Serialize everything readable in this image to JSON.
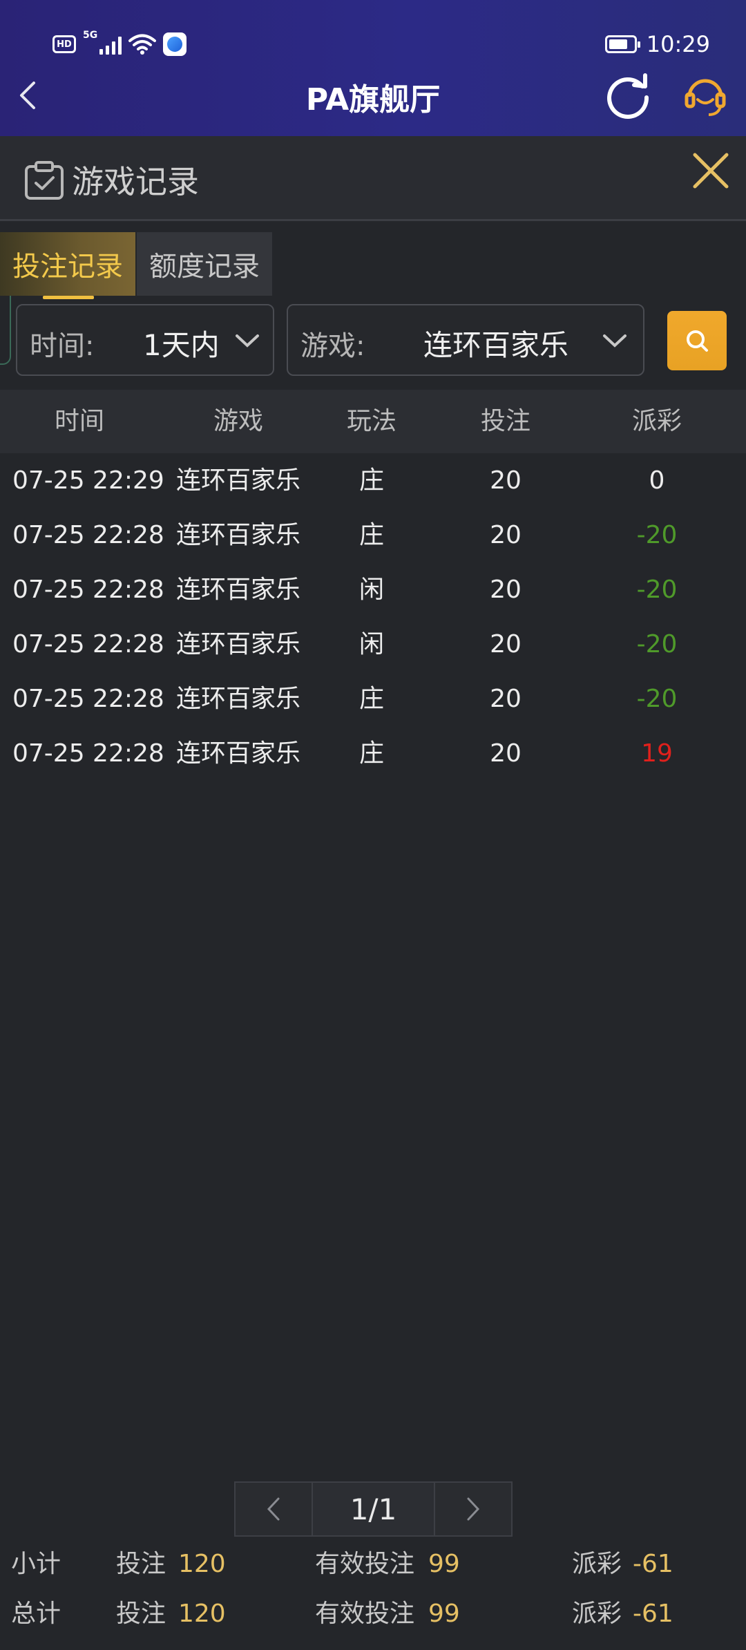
{
  "status": {
    "time": "10:29",
    "hd": "HD",
    "network": "5G"
  },
  "header": {
    "title": "PA旗舰厅"
  },
  "section": {
    "title": "游戏记录"
  },
  "tabs": [
    {
      "label": "投注记录",
      "active": true
    },
    {
      "label": "额度记录",
      "active": false
    }
  ],
  "filters": {
    "time": {
      "label": "时间:",
      "value": "1天内"
    },
    "game": {
      "label": "游戏:",
      "value": "连环百家乐"
    }
  },
  "table": {
    "columns": [
      "时间",
      "游戏",
      "玩法",
      "投注",
      "派彩"
    ],
    "rows": [
      {
        "time": "07-25 22:29",
        "game": "连环百家乐",
        "play": "庄",
        "bet": "20",
        "payout": "0"
      },
      {
        "time": "07-25 22:28",
        "game": "连环百家乐",
        "play": "庄",
        "bet": "20",
        "payout": "-20"
      },
      {
        "time": "07-25 22:28",
        "game": "连环百家乐",
        "play": "闲",
        "bet": "20",
        "payout": "-20"
      },
      {
        "time": "07-25 22:28",
        "game": "连环百家乐",
        "play": "闲",
        "bet": "20",
        "payout": "-20"
      },
      {
        "time": "07-25 22:28",
        "game": "连环百家乐",
        "play": "庄",
        "bet": "20",
        "payout": "-20"
      },
      {
        "time": "07-25 22:28",
        "game": "连环百家乐",
        "play": "庄",
        "bet": "20",
        "payout": "19"
      }
    ]
  },
  "colors": {
    "accent": "#f0c040",
    "negative": "#4f9a2a",
    "positive": "#e0201c",
    "neutral": "#ededed"
  },
  "pagination": {
    "label": "1/1"
  },
  "summary": {
    "subtotal": {
      "label": "小计",
      "bet_label": "投注",
      "bet": "120",
      "valid_label": "有效投注",
      "valid": "99",
      "payout_label": "派彩",
      "payout": "-61"
    },
    "total": {
      "label": "总计",
      "bet_label": "投注",
      "bet": "120",
      "valid_label": "有效投注",
      "valid": "99",
      "payout_label": "派彩",
      "payout": "-61"
    }
  }
}
